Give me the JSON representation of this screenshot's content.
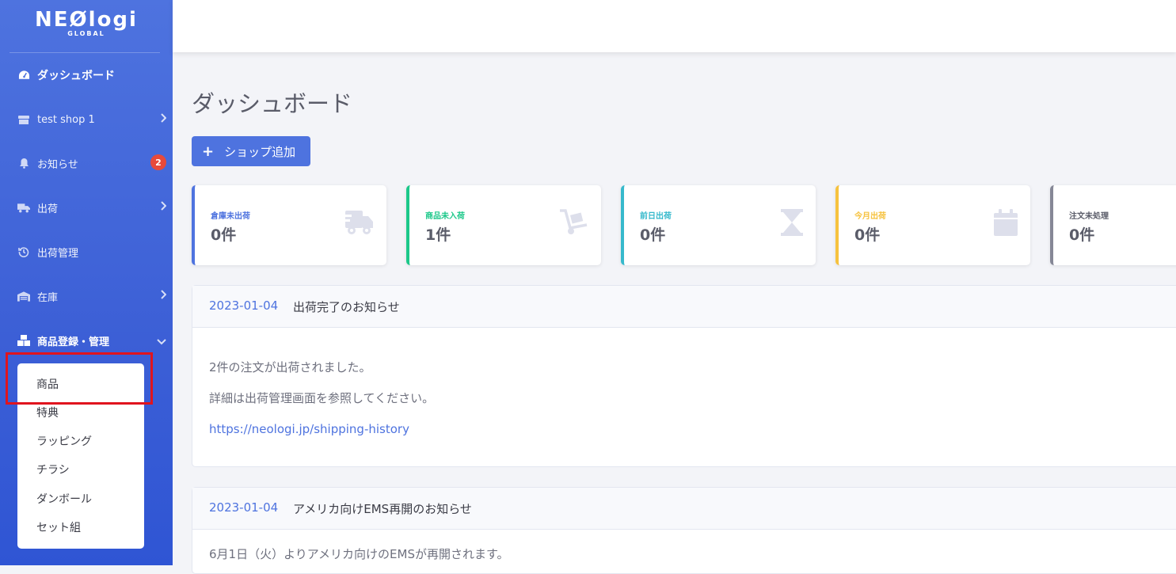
{
  "brand": {
    "name": "NEØlogi",
    "sub": "GLOBAL"
  },
  "sidebar": {
    "items": [
      {
        "label": "ダッシュボード",
        "icon": "tachometer-icon"
      },
      {
        "label": "test shop 1",
        "icon": "store-icon"
      },
      {
        "label": "お知らせ",
        "icon": "bell-icon",
        "badge": "2"
      },
      {
        "label": "出荷",
        "icon": "truck-icon"
      },
      {
        "label": "出荷管理",
        "icon": "history-icon"
      },
      {
        "label": "在庫",
        "icon": "warehouse-icon"
      },
      {
        "label": "商品登録・管理",
        "icon": "boxes-icon"
      }
    ],
    "submenu": [
      "商品",
      "特典",
      "ラッピング",
      "チラシ",
      "ダンボール",
      "セット組"
    ]
  },
  "main": {
    "title": "ダッシュボード",
    "add_button": "ショップ追加"
  },
  "cards": [
    {
      "label": "倉庫未出荷",
      "value": "0件",
      "color": "#4e73df",
      "icon": "shipping-fast-icon"
    },
    {
      "label": "商品未入荷",
      "value": "1件",
      "color": "#1cc88a",
      "icon": "dolly-icon"
    },
    {
      "label": "前日出荷",
      "value": "0件",
      "color": "#36b9cc",
      "icon": "hourglass-icon"
    },
    {
      "label": "今月出荷",
      "value": "0件",
      "color": "#f6c23e",
      "icon": "calendar-icon"
    },
    {
      "label": "注文未処理",
      "value": "0件",
      "color": "#858796",
      "icon": "list-icon"
    }
  ],
  "news": [
    {
      "date": "2023-01-04",
      "title": "出荷完了のお知らせ",
      "lines": [
        "2件の注文が出荷されました。",
        "詳細は出荷管理画面を参照してください。"
      ],
      "link": "https://neologi.jp/shipping-history"
    },
    {
      "date": "2023-01-04",
      "title": "アメリカ向けEMS再開のお知らせ",
      "lines": [
        "6月1日（火）よりアメリカ向けのEMSが再開されます。"
      ]
    }
  ]
}
